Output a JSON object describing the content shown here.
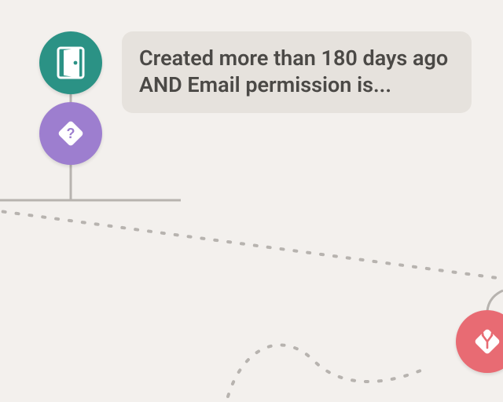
{
  "colors": {
    "entry": "#2b9285",
    "decision": "#9d7ecf",
    "split": "#e86b73",
    "label_bg": "#e6e2dd",
    "canvas_bg": "#f3f0ed",
    "connector": "#b7b3af"
  },
  "nodes": {
    "entry": {
      "icon": "door-icon",
      "label": "Created more than 180 days ago AND Email permission is..."
    },
    "decision": {
      "icon": "question-diamond-icon"
    },
    "split": {
      "icon": "branch-diamond-icon"
    }
  }
}
